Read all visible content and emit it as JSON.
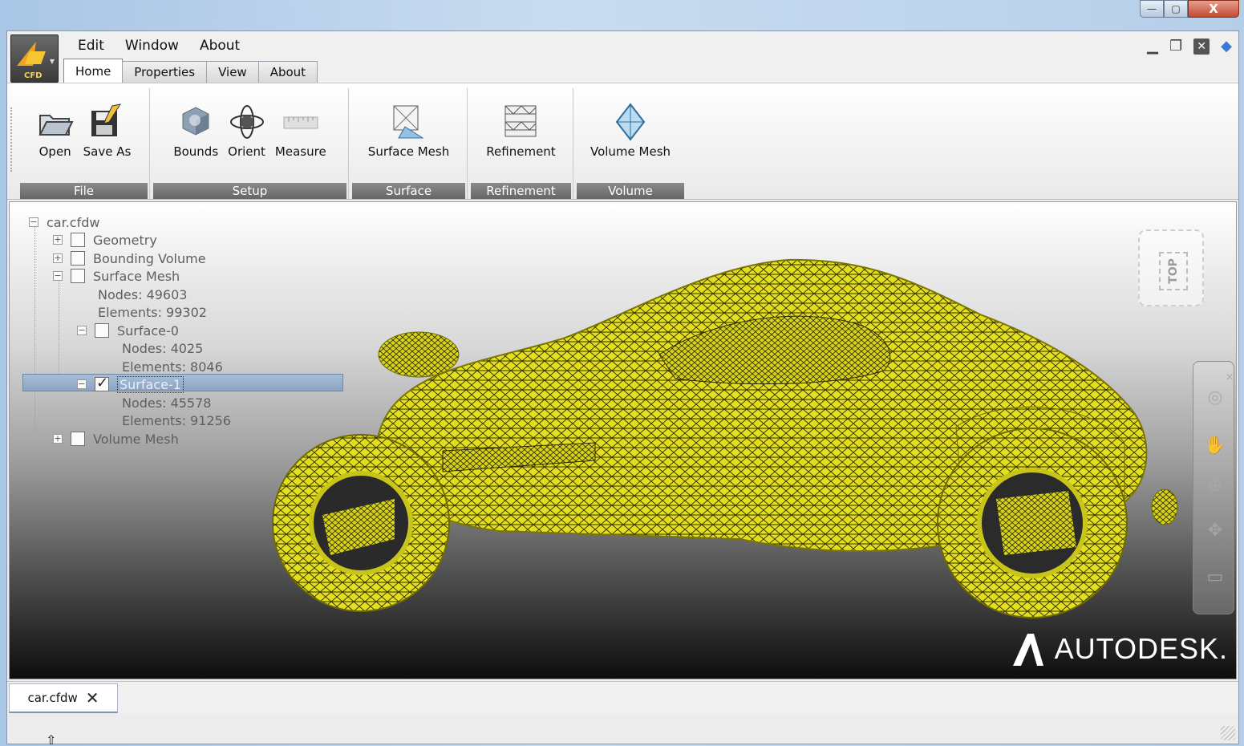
{
  "window": {
    "controls": {
      "minimize": "—",
      "maximize": "▢",
      "close": "X"
    }
  },
  "app": {
    "logo_text": "CFD"
  },
  "menu": [
    "Edit",
    "Window",
    "About"
  ],
  "tabs": [
    {
      "label": "Home",
      "active": true
    },
    {
      "label": "Properties",
      "active": false
    },
    {
      "label": "View",
      "active": false
    },
    {
      "label": "About",
      "active": false
    }
  ],
  "ribbon": {
    "groups": [
      {
        "label": "File",
        "buttons": [
          {
            "label": "Open",
            "icon": "folder-open-icon"
          },
          {
            "label": "Save As",
            "icon": "save-as-icon"
          }
        ]
      },
      {
        "label": "Setup",
        "buttons": [
          {
            "label": "Bounds",
            "icon": "cube-icon"
          },
          {
            "label": "Orient",
            "icon": "orient-icon"
          },
          {
            "label": "Measure",
            "icon": "measure-icon"
          }
        ]
      },
      {
        "label": "Surface",
        "buttons": [
          {
            "label": "Surface Mesh",
            "icon": "surface-mesh-icon"
          }
        ]
      },
      {
        "label": "Refinement",
        "buttons": [
          {
            "label": "Refinement",
            "icon": "refinement-icon"
          }
        ]
      },
      {
        "label": "Volume",
        "buttons": [
          {
            "label": "Volume Mesh",
            "icon": "volume-mesh-icon"
          }
        ]
      }
    ]
  },
  "tree": {
    "root": "car.cfdw",
    "geometry": "Geometry",
    "bounding_volume": "Bounding Volume",
    "surface_mesh": "Surface Mesh",
    "sm_nodes": "Nodes: 49603",
    "sm_elements": "Elements: 99302",
    "surface0": "Surface-0",
    "s0_nodes": "Nodes: 4025",
    "s0_elements": "Elements: 8046",
    "surface1": "Surface-1",
    "s1_nodes": "Nodes: 45578",
    "s1_elements": "Elements: 91256",
    "volume_mesh": "Volume Mesh"
  },
  "viewcube": {
    "face": "TOP"
  },
  "brand": {
    "name": "AUTODESK."
  },
  "document_tab": {
    "label": "car.cfdw"
  },
  "colors": {
    "mesh": "#e8e620",
    "mesh_lines": "#3a3500",
    "selection": "#9bb2cf",
    "ribbon_label": "#777777"
  }
}
